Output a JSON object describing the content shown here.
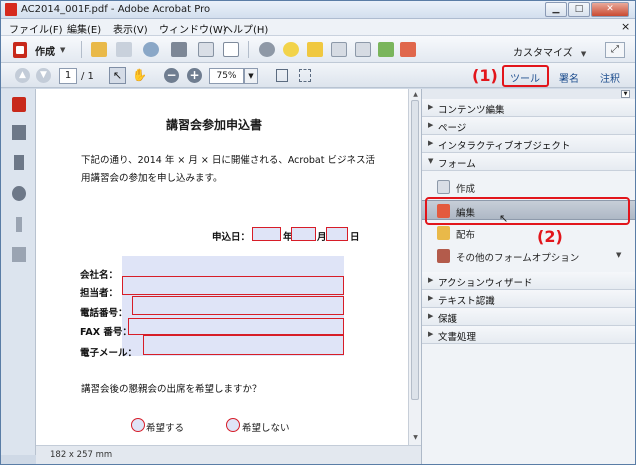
{
  "window": {
    "title": "AC2014_001F.pdf - Adobe Acrobat Pro",
    "controls": {
      "minimize": "▁",
      "maximize": "□",
      "close": "✕"
    }
  },
  "menubar": {
    "items": [
      "ファイル(F)",
      "編集(E)",
      "表示(V)",
      "ウィンドウ(W)",
      "ヘルプ(H)"
    ],
    "close": "×"
  },
  "toolbar": {
    "create_label": "作成",
    "customize_label": "カスタマイズ",
    "page_current": "1",
    "page_total": "/ 1",
    "zoom_value": "75%",
    "tabs": {
      "tools": "ツール",
      "sign": "署名",
      "comment": "注釈"
    }
  },
  "callouts": {
    "one": "(1)",
    "two": "(2)"
  },
  "document": {
    "title": "講習会参加申込書",
    "intro_line1": "下記の通り、2014 年 × 月 × 日に開催される、Acrobat ビジネス活",
    "intro_line2": "用講習会の参加を申し込みます。",
    "apply_date_label": "申込日：",
    "year_label": "年",
    "month_label": "月",
    "day_label": "日",
    "fields": {
      "company": "会社名：",
      "person": "担当者：",
      "phone": "電話番号：",
      "fax": "FAX 番号：",
      "email": "電子メール："
    },
    "question": "講習会後の懇親会の出席を希望しますか？",
    "radio_yes": "希望する",
    "radio_no": "希望しない"
  },
  "statusbar": {
    "page_size": "182 x 257 mm"
  },
  "tools_panel": {
    "sections": {
      "contents": "コンテンツ編集",
      "pages": "ページ",
      "interactive": "インタラクティブオブジェクト",
      "forms": "フォーム",
      "action_wizard": "アクションウィザード",
      "text_recognition": "テキスト認識",
      "protection": "保護",
      "document_processing": "文書処理"
    },
    "forms_items": {
      "create": "作成",
      "edit": "編集",
      "distribute": "配布",
      "other_options": "その他のフォームオプション"
    }
  },
  "colors": {
    "callout_red": "#e2151b",
    "form_field_fill": "#dfe4f7",
    "form_field_border": "#d71d28",
    "acrobat_red": "#c8291b"
  },
  "icons": {
    "nav_panel": [
      "pdf-page-icon",
      "pages-icon",
      "bookmark-icon",
      "layers-icon",
      "attachment-icon",
      "signature-icon"
    ]
  }
}
